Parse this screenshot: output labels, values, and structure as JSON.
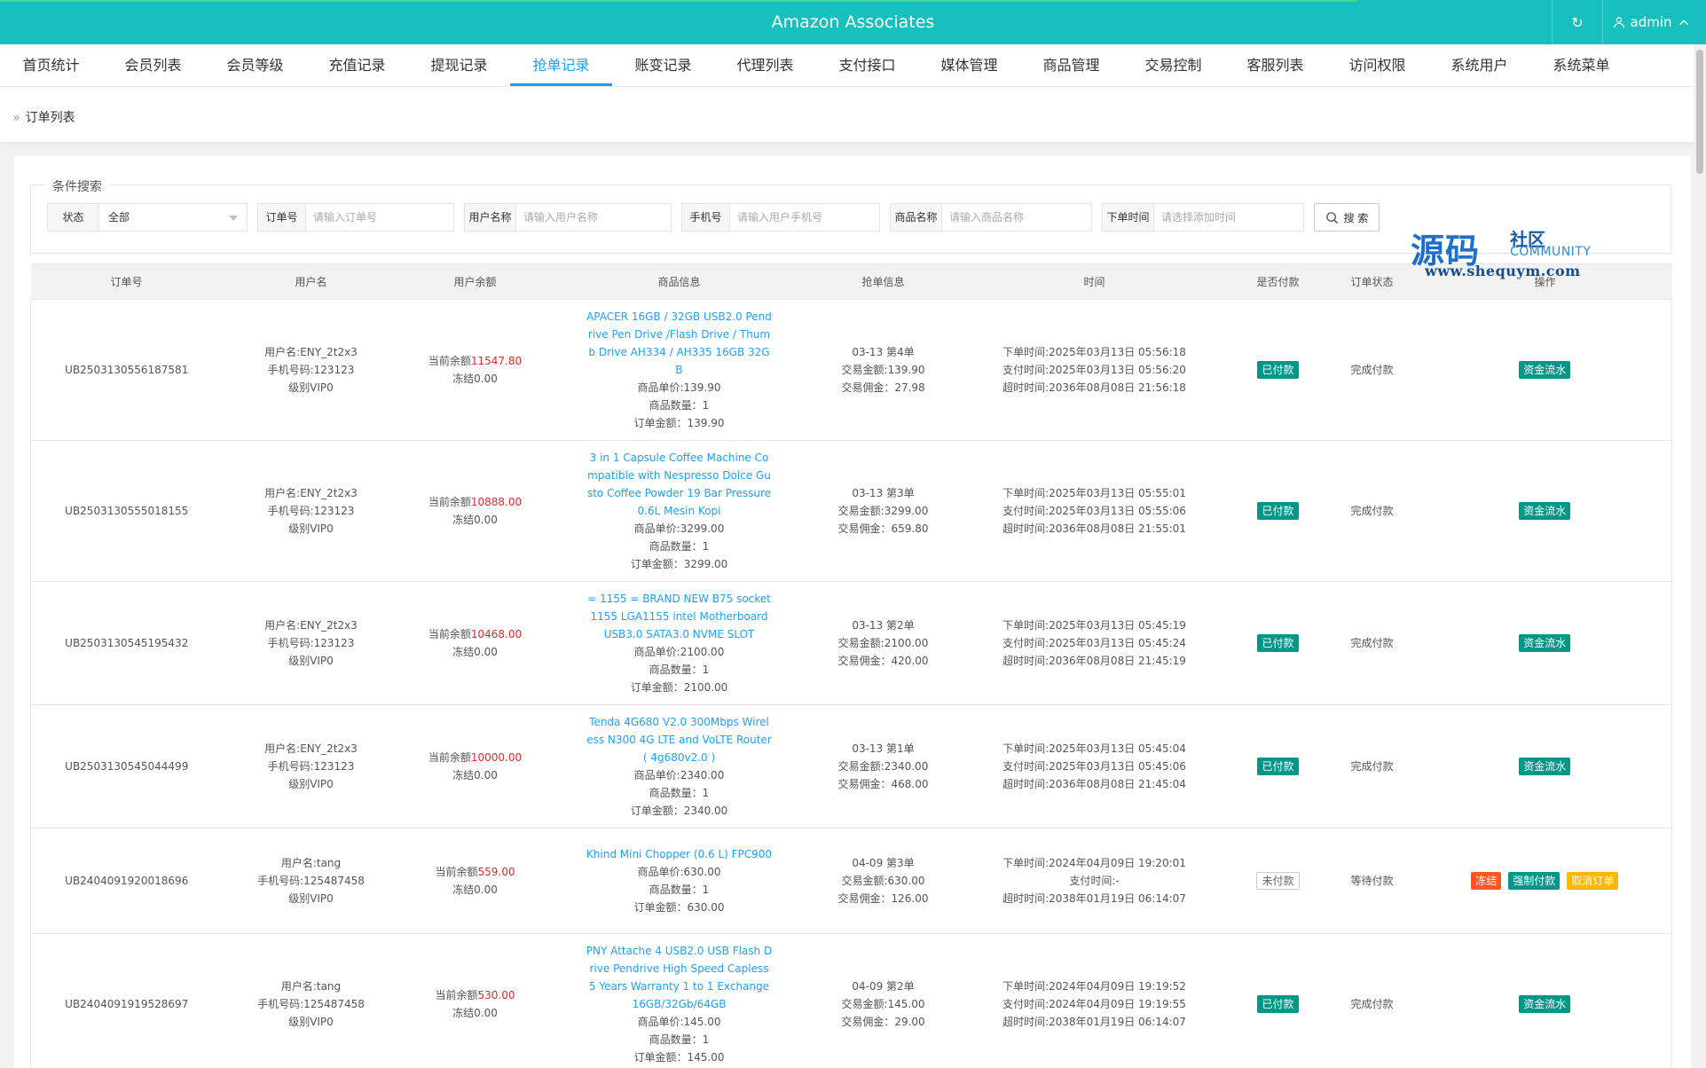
{
  "header": {
    "title": "Amazon Associates",
    "refresh_icon": "refresh-icon",
    "user": "admin"
  },
  "nav": [
    {
      "label": "首页统计"
    },
    {
      "label": "会员列表"
    },
    {
      "label": "会员等级"
    },
    {
      "label": "充值记录"
    },
    {
      "label": "提现记录"
    },
    {
      "label": "抢单记录",
      "active": true
    },
    {
      "label": "账变记录"
    },
    {
      "label": "代理列表"
    },
    {
      "label": "支付接口"
    },
    {
      "label": "媒体管理"
    },
    {
      "label": "商品管理"
    },
    {
      "label": "交易控制"
    },
    {
      "label": "客服列表"
    },
    {
      "label": "访问权限"
    },
    {
      "label": "系统用户"
    },
    {
      "label": "系统菜单"
    }
  ],
  "breadcrumb": "订单列表",
  "search": {
    "legend": "条件搜索",
    "status_label": "状态",
    "status_value": "全部",
    "order_label": "订单号",
    "order_placeholder": "请输入订单号",
    "user_label": "用户名称",
    "user_placeholder": "请输入用户名称",
    "phone_label": "手机号",
    "phone_placeholder": "请输入用户手机号",
    "product_label": "商品名称",
    "product_placeholder": "请输入商品名称",
    "time_label": "下单时间",
    "time_placeholder": "请选择添加时间",
    "button": "搜 索"
  },
  "watermark": {
    "main": "源码",
    "sub1": "社区",
    "sub2": "COMMUNITY",
    "url": "www.shequym.com"
  },
  "table": {
    "headers": [
      "订单号",
      "用户名",
      "用户余额",
      "商品信息",
      "抢单信息",
      "时间",
      "是否付款",
      "订单状态",
      "操作"
    ],
    "rows": [
      {
        "order": "UB2503130556187581",
        "user": [
          "用户名:ENY_2t2x3",
          "手机号码:123123",
          "级别VIP0"
        ],
        "bal_label": "当前余额",
        "bal": "11547.80",
        "frozen": "冻结0.00",
        "product": "APACER 16GB / 32GB USB2.0 Pendrive Pen Drive /Flash Drive / Thumb Drive AH334 / AH335 16GB 32GB",
        "prod_lines": [
          "商品单价:139.90",
          "商品数量：1",
          "订单金额：139.90"
        ],
        "grab": [
          "03-13 第4单",
          "交易金额:139.90",
          "交易佣金：27.98"
        ],
        "time": [
          "下单时间:2025年03月13日 05:56:18",
          "支付时间:2025年03月13日 05:56:20",
          "超时时间:2036年08月08日 21:56:18"
        ],
        "paid": "已付款",
        "status": "完成付款",
        "ops": [
          "资金流水"
        ]
      },
      {
        "order": "UB2503130555018155",
        "user": [
          "用户名:ENY_2t2x3",
          "手机号码:123123",
          "级别VIP0"
        ],
        "bal_label": "当前余额",
        "bal": "10888.00",
        "frozen": "冻结0.00",
        "product": "3 in 1 Capsule Coffee Machine Compatible with Nespresso Dolce Gusto Coffee Powder 19 Bar Pressure 0.6L Mesin Kopi",
        "prod_lines": [
          "商品单价:3299.00",
          "商品数量：1",
          "订单金额：3299.00"
        ],
        "grab": [
          "03-13 第3单",
          "交易金额:3299.00",
          "交易佣金：659.80"
        ],
        "time": [
          "下单时间:2025年03月13日 05:55:01",
          "支付时间:2025年03月13日 05:55:06",
          "超时时间:2036年08月08日 21:55:01"
        ],
        "paid": "已付款",
        "status": "完成付款",
        "ops": [
          "资金流水"
        ]
      },
      {
        "order": "UB2503130545195432",
        "user": [
          "用户名:ENY_2t2x3",
          "手机号码:123123",
          "级别VIP0"
        ],
        "bal_label": "当前余额",
        "bal": "10468.00",
        "frozen": "冻结0.00",
        "product": "= 1155 = BRAND NEW B75 socket 1155 LGA1155 intel Motherboard USB3.0 SATA3.0 NVME SLOT",
        "prod_lines": [
          "商品单价:2100.00",
          "商品数量：1",
          "订单金额：2100.00"
        ],
        "grab": [
          "03-13 第2单",
          "交易金额:2100.00",
          "交易佣金：420.00"
        ],
        "time": [
          "下单时间:2025年03月13日 05:45:19",
          "支付时间:2025年03月13日 05:45:24",
          "超时时间:2036年08月08日 21:45:19"
        ],
        "paid": "已付款",
        "status": "完成付款",
        "ops": [
          "资金流水"
        ]
      },
      {
        "order": "UB2503130545044499",
        "user": [
          "用户名:ENY_2t2x3",
          "手机号码:123123",
          "级别VIP0"
        ],
        "bal_label": "当前余额",
        "bal": "10000.00",
        "frozen": "冻结0.00",
        "product": "Tenda 4G680 V2.0 300Mbps Wireless N300 4G LTE and VoLTE Router ( 4g680v2.0 )",
        "prod_lines": [
          "商品单价:2340.00",
          "商品数量：1",
          "订单金额：2340.00"
        ],
        "grab": [
          "03-13 第1单",
          "交易金额:2340.00",
          "交易佣金：468.00"
        ],
        "time": [
          "下单时间:2025年03月13日 05:45:04",
          "支付时间:2025年03月13日 05:45:06",
          "超时时间:2036年08月08日 21:45:04"
        ],
        "paid": "已付款",
        "status": "完成付款",
        "ops": [
          "资金流水"
        ]
      },
      {
        "order": "UB2404091920018696",
        "user": [
          "用户名:tang",
          "手机号码:125487458",
          "级别VIP0"
        ],
        "bal_label": "当前余额",
        "bal": "559.00",
        "frozen": "冻结0.00",
        "product": "Khind Mini Chopper (0.6 L) FPC900",
        "prod_lines": [
          "商品单价:630.00",
          "商品数量：1",
          "订单金额：630.00"
        ],
        "grab": [
          "04-09 第3单",
          "交易金额:630.00",
          "交易佣金：126.00"
        ],
        "time": [
          "下单时间:2024年04月09日 19:20:01",
          "支付时间:-",
          "超时时间:2038年01月19日 06:14:07"
        ],
        "paid": "未付款",
        "status": "等待付款",
        "ops": [
          "冻结",
          "强制付款",
          "取消订单"
        ]
      },
      {
        "order": "UB2404091919528697",
        "user": [
          "用户名:tang",
          "手机号码:125487458",
          "级别VIP0"
        ],
        "bal_label": "当前余额",
        "bal": "530.00",
        "frozen": "冻结0.00",
        "product": "PNY Attache 4 USB2.0 USB Flash Drive Pendrive High Speed Capless 5 Years Warranty 1 to 1 Exchange 16GB/32Gb/64GB",
        "prod_lines": [
          "商品单价:145.00",
          "商品数量：1",
          "订单金额：145.00"
        ],
        "grab": [
          "04-09 第2单",
          "交易金额:145.00",
          "交易佣金：29.00"
        ],
        "time": [
          "下单时间:2024年04月09日 19:19:52",
          "支付时间:2024年04月09日 19:19:55",
          "超时时间:2038年01月19日 06:14:07"
        ],
        "paid": "已付款",
        "status": "完成付款",
        "ops": [
          "资金流水"
        ]
      }
    ]
  }
}
